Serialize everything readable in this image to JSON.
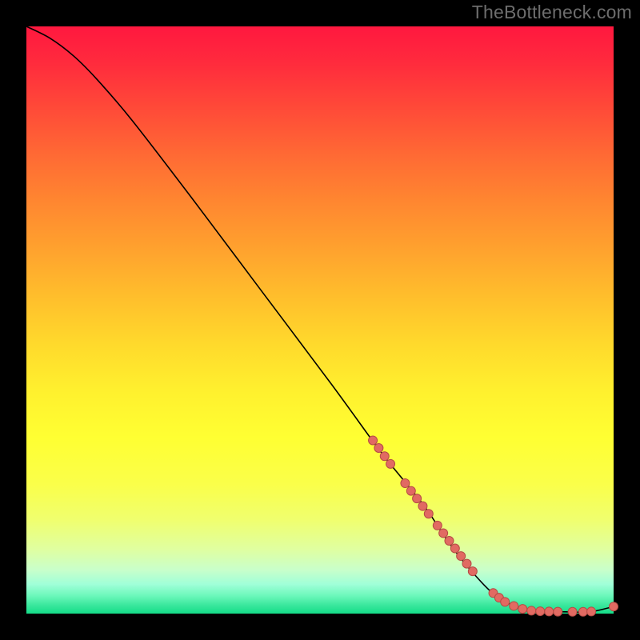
{
  "watermark": "TheBottleneck.com",
  "chart_data": {
    "type": "line",
    "title": "",
    "xlabel": "",
    "ylabel": "",
    "xlim": [
      0,
      100
    ],
    "ylim": [
      0,
      100
    ],
    "grid": false,
    "series": [
      {
        "name": "curve",
        "x": [
          0,
          4,
          8,
          12,
          18,
          28,
          40,
          52,
          60,
          64,
          68,
          72,
          76,
          80,
          84,
          88,
          92,
          96,
          100
        ],
        "y": [
          100,
          98,
          95,
          91,
          84,
          71,
          55,
          39,
          28,
          23,
          18,
          12,
          7,
          3,
          1,
          0.4,
          0.3,
          0.3,
          1.2
        ]
      }
    ],
    "markers": [
      {
        "x": 59.0,
        "y": 29.5
      },
      {
        "x": 60.0,
        "y": 28.2
      },
      {
        "x": 61.0,
        "y": 26.8
      },
      {
        "x": 62.0,
        "y": 25.5
      },
      {
        "x": 64.5,
        "y": 22.2
      },
      {
        "x": 65.5,
        "y": 20.9
      },
      {
        "x": 66.5,
        "y": 19.6
      },
      {
        "x": 67.5,
        "y": 18.3
      },
      {
        "x": 68.5,
        "y": 17.0
      },
      {
        "x": 70.0,
        "y": 15.0
      },
      {
        "x": 71.0,
        "y": 13.7
      },
      {
        "x": 72.0,
        "y": 12.4
      },
      {
        "x": 73.0,
        "y": 11.1
      },
      {
        "x": 74.0,
        "y": 9.8
      },
      {
        "x": 75.0,
        "y": 8.5
      },
      {
        "x": 76.0,
        "y": 7.2
      },
      {
        "x": 79.5,
        "y": 3.5
      },
      {
        "x": 80.5,
        "y": 2.7
      },
      {
        "x": 81.5,
        "y": 2.0
      },
      {
        "x": 83.0,
        "y": 1.3
      },
      {
        "x": 84.5,
        "y": 0.8
      },
      {
        "x": 86.0,
        "y": 0.5
      },
      {
        "x": 87.5,
        "y": 0.4
      },
      {
        "x": 89.0,
        "y": 0.35
      },
      {
        "x": 90.5,
        "y": 0.32
      },
      {
        "x": 93.0,
        "y": 0.3
      },
      {
        "x": 94.8,
        "y": 0.3
      },
      {
        "x": 96.2,
        "y": 0.35
      },
      {
        "x": 100.0,
        "y": 1.2
      }
    ],
    "marker_style": {
      "shape": "circle",
      "radius_px": 5.5,
      "fill": "#e16a62",
      "stroke": "#b54a44",
      "stroke_width": 1
    },
    "line_style": {
      "stroke": "#000000",
      "stroke_width": 1.6
    }
  }
}
